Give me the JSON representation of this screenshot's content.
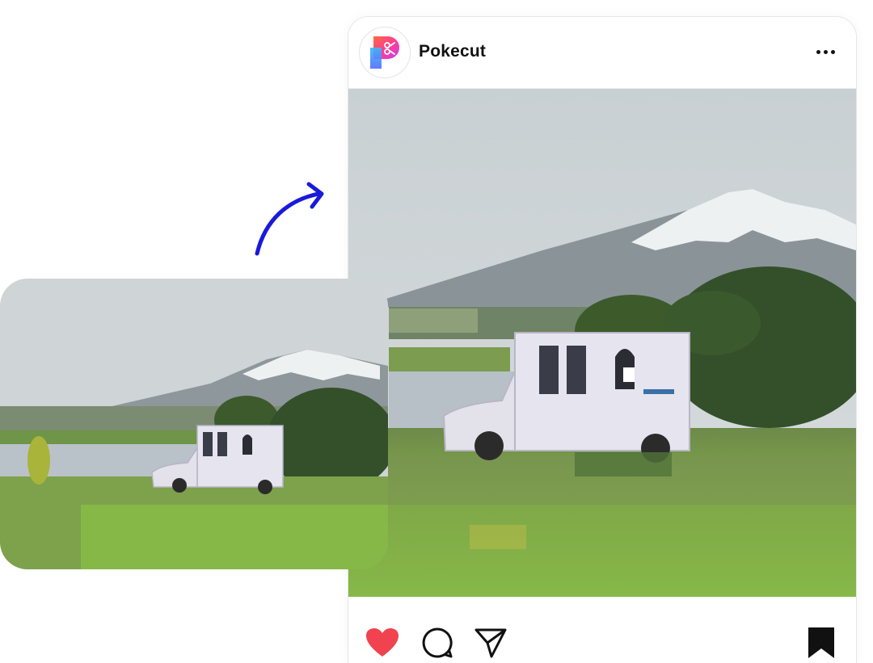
{
  "post": {
    "username": "Pokecut",
    "avatar_icon": "pokecut-logo-icon",
    "more_icon": "more-options-icon"
  },
  "actions": {
    "like_icon": "heart-icon",
    "comment_icon": "comment-icon",
    "share_icon": "send-icon",
    "save_icon": "bookmark-icon"
  },
  "colors": {
    "accent_arrow": "#1a1adb",
    "like": "#f0434f",
    "text": "#111111"
  }
}
